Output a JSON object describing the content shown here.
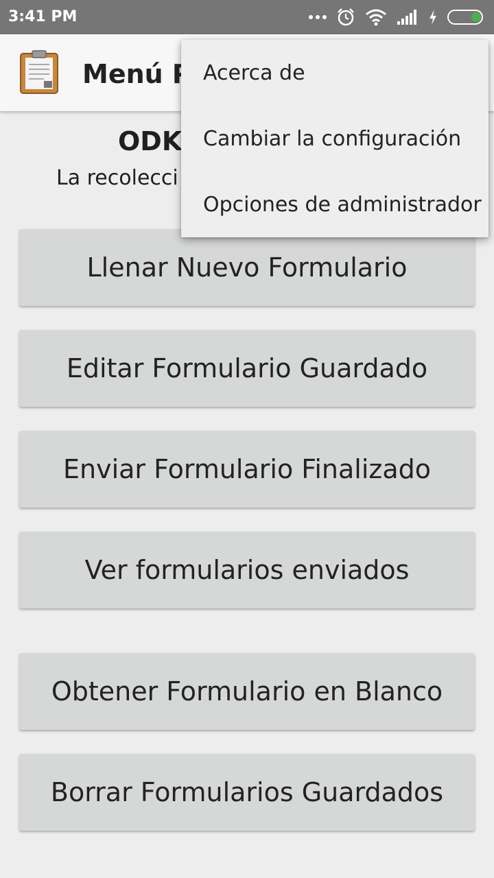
{
  "status_bar": {
    "time": "3:41 PM",
    "icons": [
      "more-dots-icon",
      "alarm-icon",
      "wifi-icon",
      "signal-icon",
      "charging-icon",
      "battery-icon"
    ]
  },
  "app_bar": {
    "title": "Menú Pr",
    "logo_icon": "clipboard-icon"
  },
  "header": {
    "title": "ODK",
    "subtitle": "La recolecci"
  },
  "buttons": [
    "Llenar Nuevo Formulario",
    "Editar Formulario Guardado",
    "Enviar Formulario Finalizado",
    "Ver formularios enviados",
    "Obtener Formulario en Blanco",
    "Borrar Formularios Guardados"
  ],
  "menu": {
    "items": [
      "Acerca de",
      "Cambiar la configuración",
      "Opciones de administrador"
    ]
  },
  "colors": {
    "status_bar": "#767676",
    "background": "#ededed",
    "button": "#d6d7d7",
    "menu": "#eeeeee",
    "battery_accent": "#4caf50"
  }
}
